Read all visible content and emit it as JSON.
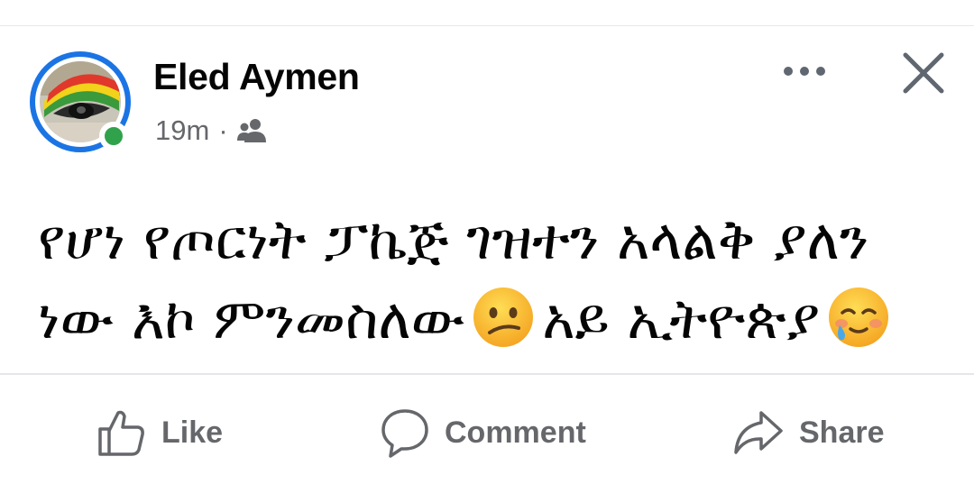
{
  "post": {
    "author_name": "Eled Aymen",
    "timestamp": "19m",
    "separator": "·",
    "audience_icon": "friends-icon",
    "online_status_color": "#31a24c",
    "avatar_ring_color": "#1b74e4",
    "text_line_1": "የሆነ የጦርነት ፓኬጅ ገዝተን አላልቅ ያለን",
    "text_line_2a": "ነው እኮ ምንመስለው",
    "emoji_1": "confused-face-emoji",
    "text_line_2b": "አይ ኢትዮጵያ",
    "emoji_2": "face-holding-back-tears-emoji"
  },
  "header_actions": {
    "more_icon": "more-horizontal-icon",
    "close_icon": "close-icon"
  },
  "actions": {
    "like_label": "Like",
    "comment_label": "Comment",
    "share_label": "Share"
  }
}
